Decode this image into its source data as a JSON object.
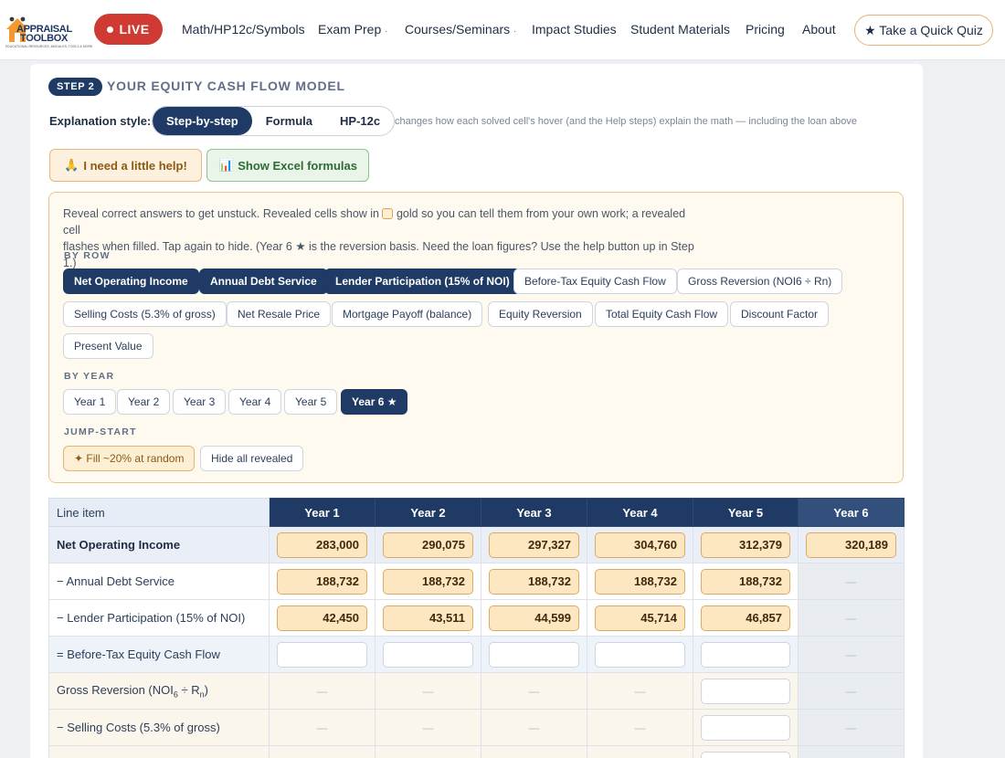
{
  "nav": {
    "logo_line1": "APPRAISAL",
    "logo_line2": "TOOLBOX",
    "logo_tagline": "EDUCATIONAL RESOURCES, MODULES, TOOLS & MORE",
    "live_label": "LIVE",
    "links": [
      "Math/HP12c/Symbols",
      "Exam Prep",
      "Courses/Seminars",
      "Impact Studies",
      "Student Materials",
      "Pricing",
      "About"
    ],
    "caret": "·",
    "quiz_label": "★ Take a Quick Quiz"
  },
  "step": {
    "badge": "STEP 2",
    "title": "YOUR EQUITY CASH FLOW MODEL"
  },
  "explanation": {
    "label": "Explanation style:",
    "options": [
      "Step-by-step",
      "Formula",
      "HP-12c"
    ],
    "active": "Step-by-step",
    "hint": "changes how each solved cell's hover (and the Help steps) explain the math — including the loan above"
  },
  "buttons": {
    "help_icon": "🙏",
    "help": "I need a little help!",
    "excel_icon": "📊",
    "excel": "Show Excel formulas"
  },
  "panel": {
    "intro_a": "Reveal correct answers to get unstuck. Revealed cells show in",
    "intro_b": "gold so you can tell them from your own work; a revealed cell",
    "intro_c": "flashes when filled. Tap again to hide. (Year 6 ★ is the reversion basis. Need the loan figures? Use the help button up in Step 1.)",
    "by_row": "BY ROW",
    "rows": [
      {
        "label": "Net Operating Income",
        "on": true
      },
      {
        "label": "Annual Debt Service",
        "on": true
      },
      {
        "label": "Lender Participation (15% of NOI)",
        "on": true
      },
      {
        "label": "Before-Tax Equity Cash Flow",
        "on": false
      },
      {
        "label": "Gross Reversion (NOI6 ÷ Rn)",
        "on": false
      },
      {
        "label": "Selling Costs (5.3% of gross)",
        "on": false
      },
      {
        "label": "Net Resale Price",
        "on": false
      },
      {
        "label": "Mortgage Payoff (balance)",
        "on": false
      },
      {
        "label": "Equity Reversion",
        "on": false
      },
      {
        "label": "Total Equity Cash Flow",
        "on": false
      },
      {
        "label": "Discount Factor",
        "on": false
      },
      {
        "label": "Present Value",
        "on": false
      }
    ],
    "by_year": "BY YEAR",
    "years": [
      {
        "label": "Year 1",
        "on": false
      },
      {
        "label": "Year 2",
        "on": false
      },
      {
        "label": "Year 3",
        "on": false
      },
      {
        "label": "Year 4",
        "on": false
      },
      {
        "label": "Year 5",
        "on": false
      },
      {
        "label": "Year 6 ★",
        "on": true
      }
    ],
    "jump_start": "JUMP-START",
    "fill_random": "✦ Fill ~20% at random",
    "hide_all": "Hide all revealed"
  },
  "table": {
    "line_item_header": "Line item",
    "years": [
      "Year 1",
      "Year 2",
      "Year 3",
      "Year 4",
      "Year 5",
      "Year 6"
    ],
    "dash": "—",
    "rows": [
      {
        "label": "Net Operating Income",
        "kind": "noi",
        "cells": [
          "283,000",
          "290,075",
          "297,327",
          "304,760",
          "312,379",
          "320,189"
        ]
      },
      {
        "label": "− Annual Debt Service",
        "kind": "ops",
        "cells": [
          "188,732",
          "188,732",
          "188,732",
          "188,732",
          "188,732",
          null
        ]
      },
      {
        "label": "− Lender Participation (15% of NOI)",
        "kind": "ops",
        "cells": [
          "42,450",
          "43,511",
          "44,599",
          "45,714",
          "46,857",
          null
        ]
      },
      {
        "label": "= Before-Tax Equity Cash Flow",
        "kind": "btcf",
        "cells": [
          "",
          "",
          "",
          "",
          "",
          null
        ]
      },
      {
        "label": "Gross Reversion (NOI6 ÷ Rn)",
        "kind": "rev",
        "cells": [
          null,
          null,
          null,
          null,
          "",
          null
        ]
      },
      {
        "label": "− Selling Costs (5.3% of gross)",
        "kind": "rev",
        "cells": [
          null,
          null,
          null,
          null,
          "",
          null
        ]
      },
      {
        "label": "",
        "kind": "rev",
        "cells": [
          null,
          null,
          null,
          null,
          "",
          null
        ]
      }
    ]
  }
}
